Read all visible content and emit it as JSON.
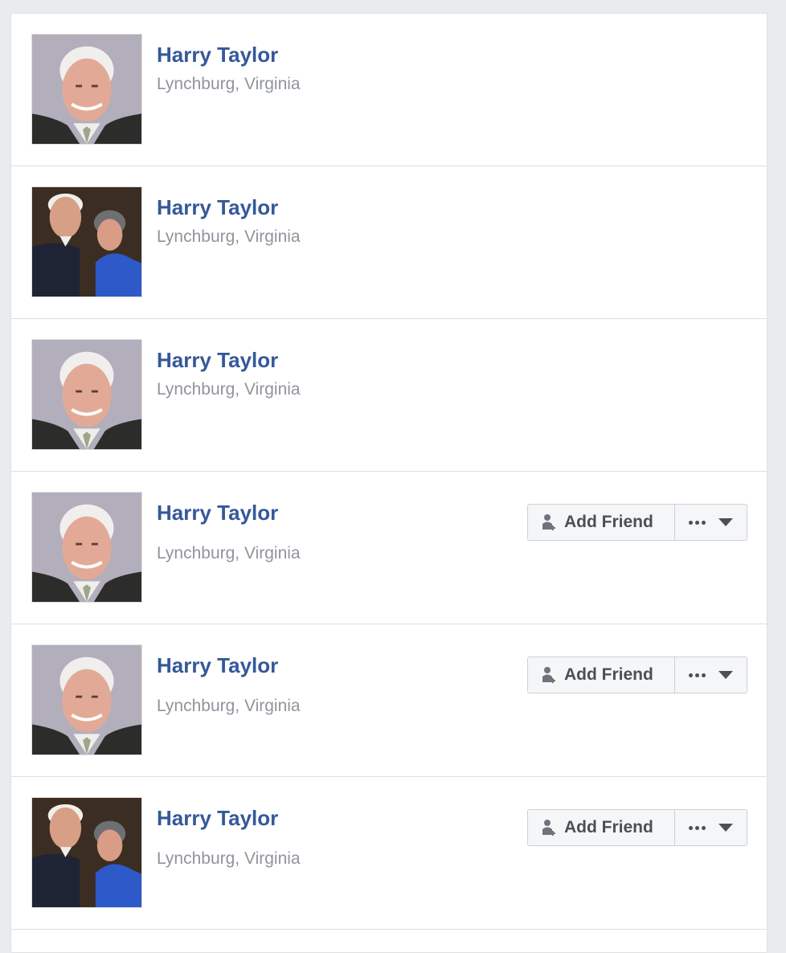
{
  "results": [
    {
      "name": "Harry Taylor",
      "location": "Lynchburg, Virginia",
      "photo": "solo-portrait"
    },
    {
      "name": "Harry Taylor",
      "location": "Lynchburg, Virginia",
      "photo": "couple-portrait"
    },
    {
      "name": "Harry Taylor",
      "location": "Lynchburg, Virginia",
      "photo": "solo-portrait"
    },
    {
      "name": "Harry Taylor",
      "location": "Lynchburg, Virginia",
      "photo": "solo-portrait",
      "add_friend_label": "Add Friend"
    },
    {
      "name": "Harry Taylor",
      "location": "Lynchburg, Virginia",
      "photo": "solo-portrait",
      "add_friend_label": "Add Friend"
    },
    {
      "name": "Harry Taylor",
      "location": "Lynchburg, Virginia",
      "photo": "couple-portrait",
      "add_friend_label": "Add Friend"
    }
  ],
  "colors": {
    "name_link": "#365899",
    "secondary_text": "#90949c",
    "button_bg": "#f5f6f7",
    "page_bg": "#e9ebee"
  },
  "icons": {
    "add_friend": "person-plus-icon",
    "more": "ellipsis-icon",
    "dropdown": "caret-down-icon"
  }
}
